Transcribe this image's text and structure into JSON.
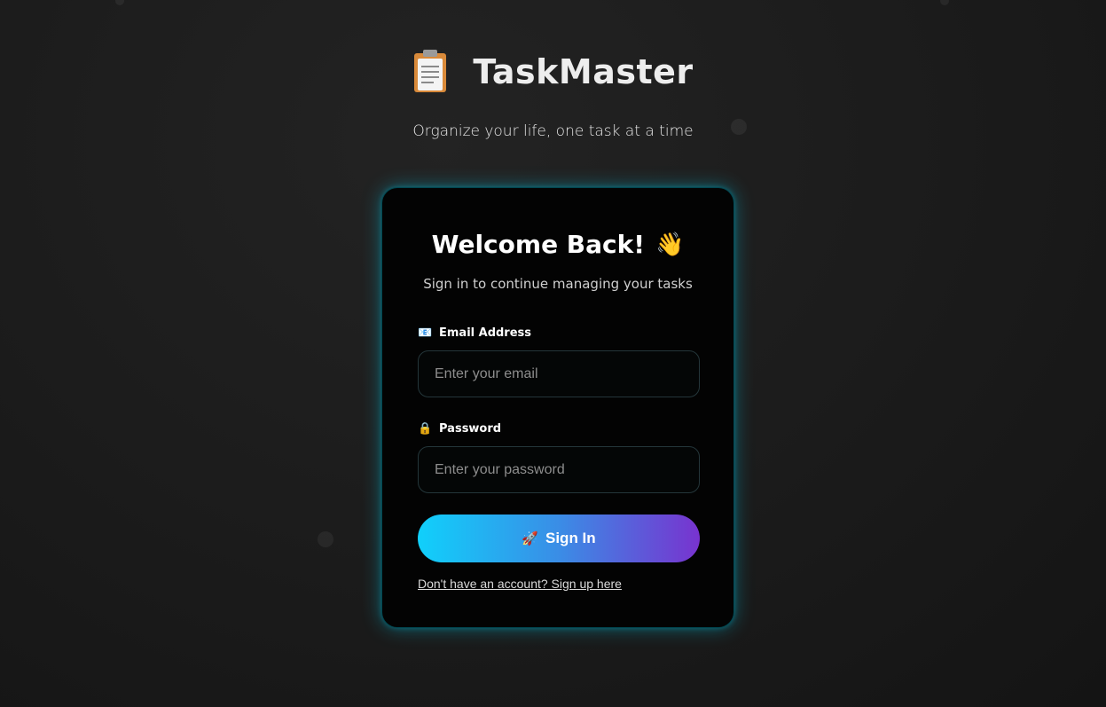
{
  "app": {
    "name": "TaskMaster",
    "logo_icon": "clipboard-icon",
    "tagline": "Organize your life, one task at a time"
  },
  "login_card": {
    "title": "Welcome Back!",
    "title_emoji": "👋",
    "subtitle": "Sign in to continue managing your tasks",
    "email": {
      "icon": "📧",
      "label": "Email Address",
      "placeholder": "Enter your email",
      "value": ""
    },
    "password": {
      "icon": "🔒",
      "label": "Password",
      "placeholder": "Enter your password",
      "value": ""
    },
    "submit": {
      "icon": "🚀",
      "label": "Sign In"
    },
    "signup_link": "Don't have an account? Sign up here"
  },
  "colors": {
    "background": "#1b1b1b",
    "card": "#030303",
    "card_glow": "#00bedc",
    "button_gradient_start": "#10d0fb",
    "button_gradient_end": "#7833cf"
  }
}
